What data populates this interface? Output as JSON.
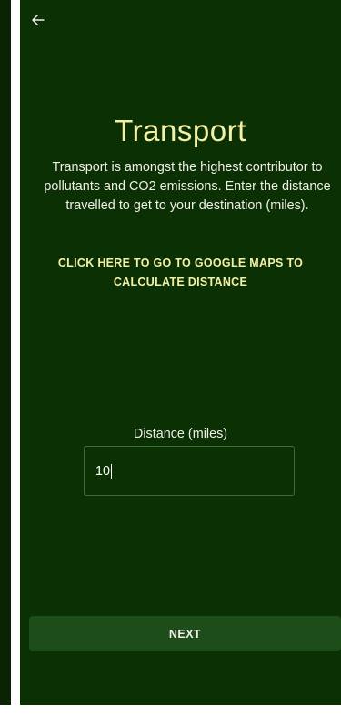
{
  "header": {
    "back_icon": "arrow-left-icon"
  },
  "page": {
    "title": "Transport",
    "description": "Transport is amongst the highest contributor to pollutants and CO2 emissions. Enter the distance travelled to get to your destination (miles).",
    "maps_link": "CLICK HERE TO GO TO GOOGLE MAPS TO CALCULATE DISTANCE"
  },
  "distance": {
    "label": "Distance (miles)",
    "value": "10"
  },
  "actions": {
    "next_label": "NEXT"
  },
  "colors": {
    "background": "#0b3004",
    "accent_text": "#f4f0a5",
    "button": "#1d4d19",
    "input_border": "#3f6d38"
  }
}
